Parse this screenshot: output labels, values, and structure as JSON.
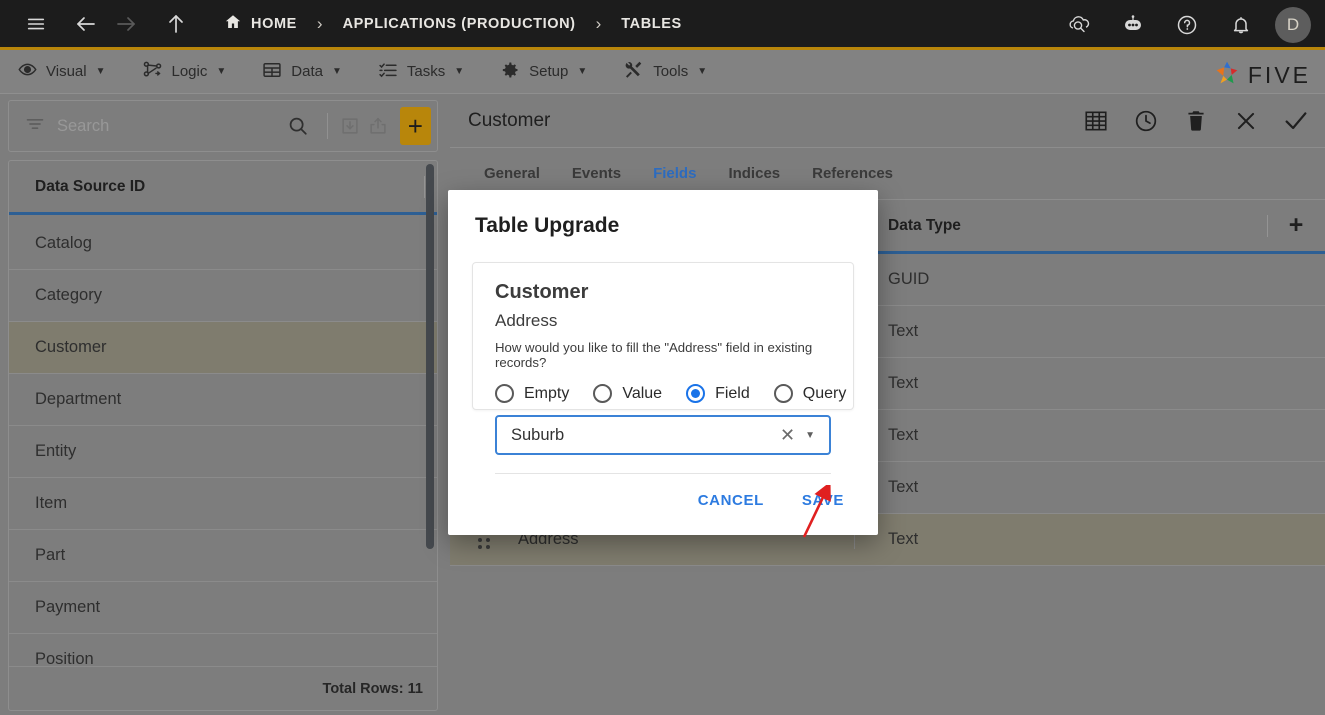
{
  "topbar": {
    "icons": [
      "hamburger-icon",
      "back-arrow-icon",
      "forward-arrow-icon",
      "up-arrow-icon"
    ],
    "breadcrumbs": [
      {
        "label": "HOME",
        "icon": "home-icon"
      },
      {
        "label": "APPLICATIONS (PRODUCTION)",
        "icon": ""
      },
      {
        "label": "TABLES",
        "icon": ""
      }
    ],
    "separator": "›",
    "right_icons": [
      "cloud-search-icon",
      "robot-icon",
      "help-icon",
      "bell-icon"
    ],
    "avatar_initial": "D"
  },
  "menubar": {
    "items": [
      {
        "label": "Visual",
        "icon": "eye-icon",
        "caret": "▼"
      },
      {
        "label": "Logic",
        "icon": "logic-nodes-icon",
        "caret": "▼"
      },
      {
        "label": "Data",
        "icon": "table-grid-icon",
        "caret": "▼"
      },
      {
        "label": "Tasks",
        "icon": "checklist-icon",
        "caret": "▼"
      },
      {
        "label": "Setup",
        "icon": "gear-icon",
        "caret": "▼"
      },
      {
        "label": "Tools",
        "icon": "wrench-screwdriver-icon",
        "caret": "▼"
      }
    ],
    "brand": "FIVE"
  },
  "sidebar": {
    "search": {
      "placeholder": "Search",
      "value": ""
    },
    "toolbar_icons": [
      "filter-icon",
      "search-icon",
      "import-icon",
      "export-icon",
      "add-icon"
    ],
    "add_label": "+",
    "column_header": "Data Source ID",
    "rows": [
      {
        "label": "Catalog",
        "selected": false
      },
      {
        "label": "Category",
        "selected": false
      },
      {
        "label": "Customer",
        "selected": true
      },
      {
        "label": "Department",
        "selected": false
      },
      {
        "label": "Entity",
        "selected": false
      },
      {
        "label": "Item",
        "selected": false
      },
      {
        "label": "Part",
        "selected": false
      },
      {
        "label": "Payment",
        "selected": false
      },
      {
        "label": "Position",
        "selected": false
      }
    ],
    "footer": "Total Rows: 11"
  },
  "main": {
    "title": "Customer",
    "head_icons": [
      "table-view-icon",
      "history-clock-icon",
      "delete-trash-icon",
      "close-x-icon",
      "confirm-check-icon"
    ],
    "tabs": [
      {
        "label": "General",
        "active": false
      },
      {
        "label": "Events",
        "active": false
      },
      {
        "label": "Fields",
        "active": true
      },
      {
        "label": "Indices",
        "active": false
      },
      {
        "label": "References",
        "active": false
      }
    ],
    "grid": {
      "columns": [
        "",
        "Data Type"
      ],
      "add_column_label": "+",
      "rows": [
        {
          "name": "",
          "type": "GUID",
          "selected": false
        },
        {
          "name": "",
          "type": "Text",
          "selected": false
        },
        {
          "name": "",
          "type": "Text",
          "selected": false
        },
        {
          "name": "",
          "type": "Text",
          "selected": false
        },
        {
          "name": "",
          "type": "Text",
          "selected": false
        },
        {
          "name": "Address",
          "type": "Text",
          "selected": true
        }
      ]
    }
  },
  "modal": {
    "title": "Table Upgrade",
    "table_name": "Customer",
    "field_name": "Address",
    "question": "How would you like to fill the \"Address\" field in existing records?",
    "options": [
      {
        "label": "Empty",
        "selected": false
      },
      {
        "label": "Value",
        "selected": false
      },
      {
        "label": "Field",
        "selected": true
      },
      {
        "label": "Query",
        "selected": false
      }
    ],
    "select_value": "Suburb",
    "clear_icon": "✕",
    "caret_icon": "▼",
    "cancel_label": "CANCEL",
    "save_label": "SAVE"
  },
  "annotation": {
    "arrow_color": "#e02020",
    "points_to": "SAVE"
  },
  "colors": {
    "topbar_bg": "#1c1c1c",
    "accent_gold": "#b8860b",
    "page_bg": "#7d7d7d",
    "selected_row": "#7f7c6e",
    "tab_active": "#2d6cc0",
    "link_blue": "#2d7be0",
    "radio_blue": "#1a73e8",
    "grid_underline": "#2d5f94"
  }
}
